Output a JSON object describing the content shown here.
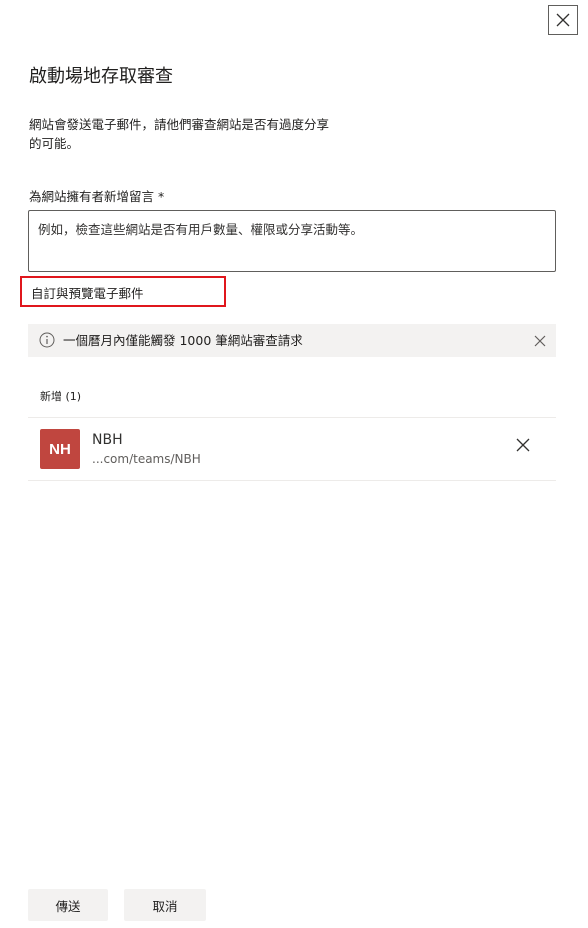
{
  "panel": {
    "title": "啟動場地存取審查",
    "description": "網站會發送電子郵件，請他們審查網站是否有過度分享的可能。",
    "close_icon": "close-icon"
  },
  "note": {
    "label": "為網站擁有者新增留言 *",
    "placeholder": "例如，檢查這些網站是否有用戶數量、權限或分享活動等。",
    "value": ""
  },
  "customize": {
    "label": "自訂與預覽電子郵件",
    "highlight_color": "#e0161c"
  },
  "info_bar": {
    "icon": "info-icon",
    "text": "一個曆月內僅能觸發 1000 筆網站審查請求",
    "dismiss_icon": "close-icon"
  },
  "added": {
    "header": "新增 (1)",
    "sites": [
      {
        "initials": "NH",
        "name": "NBH",
        "url": "...com/teams/NBH",
        "avatar_color": "#c0463f",
        "remove_icon": "close-icon"
      }
    ]
  },
  "footer": {
    "send_label": "傳送",
    "cancel_label": "取消"
  }
}
